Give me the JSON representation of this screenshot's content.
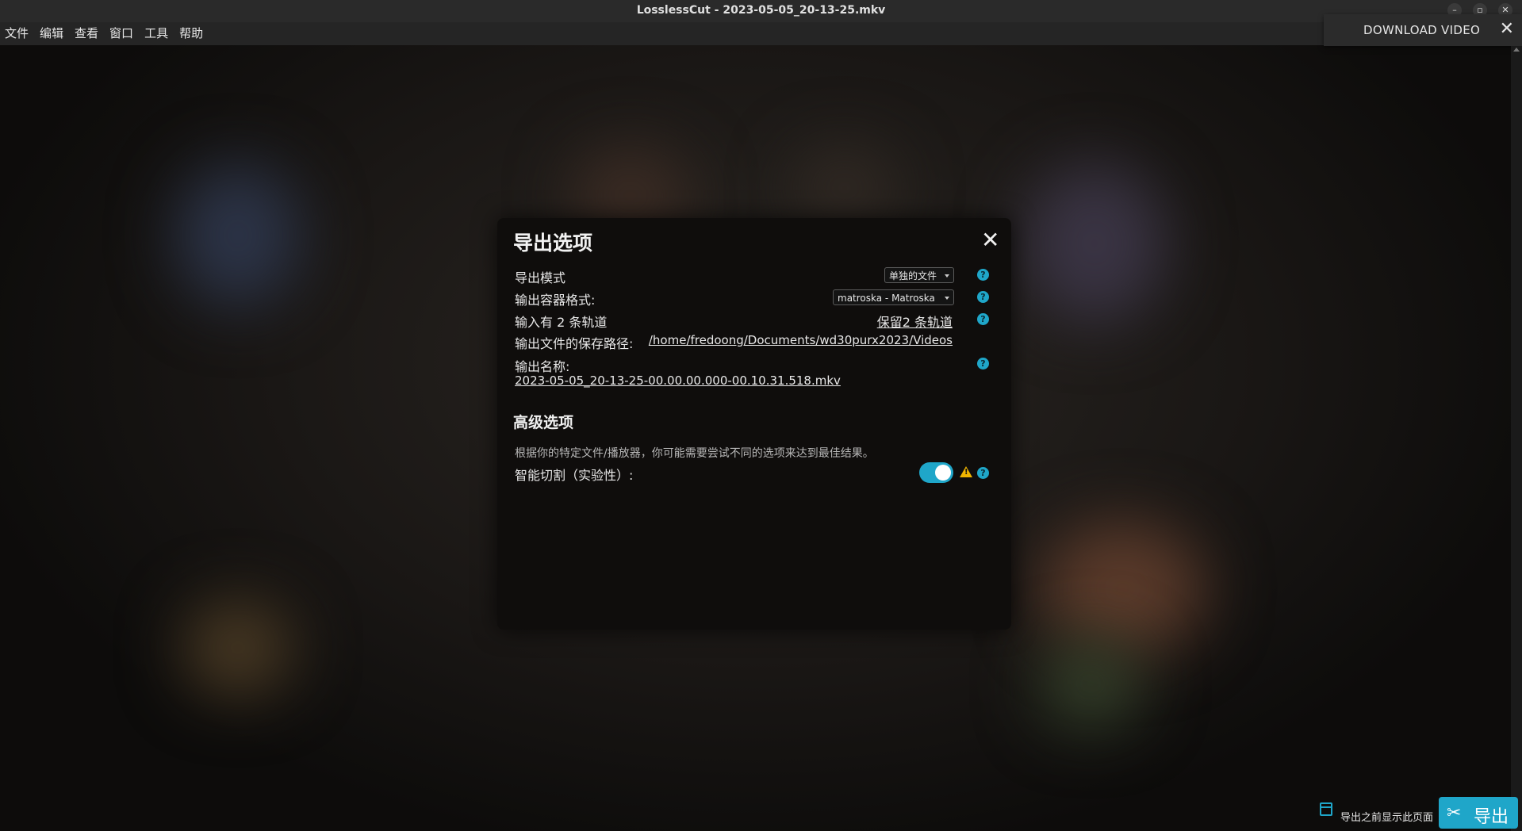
{
  "window": {
    "title": "LosslessCut - 2023-05-05_20-13-25.mkv"
  },
  "menu": {
    "items": [
      "文件",
      "编辑",
      "查看",
      "窗口",
      "工具",
      "帮助"
    ]
  },
  "download_panel": {
    "label": "DOWNLOAD VIDEO",
    "close_glyph": "✕"
  },
  "export_dialog": {
    "title": "导出选项",
    "close_glyph": "✕",
    "rows": {
      "export_mode": {
        "label": "导出模式",
        "value": "单独的文件"
      },
      "container": {
        "label": "输出容器格式:",
        "value": "matroska - Matroska"
      },
      "tracks": {
        "label": "输入有 2 条轨道",
        "value": "保留2 条轨道"
      },
      "save_path": {
        "label": "输出文件的保存路径:",
        "value": "/home/fredoong/Documents/wd30purx2023/Videos"
      },
      "output_name": {
        "label": "输出名称:",
        "value": "2023-05-05_20-13-25-00.00.00.000-00.10.31.518.mkv"
      }
    },
    "advanced": {
      "title": "高级选项",
      "description": "根据你的特定文件/播放器，你可能需要尝试不同的选项来达到最佳结果。",
      "smart_cut": {
        "label": "智能切割（实验性）:",
        "enabled": true
      }
    },
    "help_glyph": "?",
    "warning_glyph": "!"
  },
  "footer": {
    "show_page_label": "导出之前显示此页面",
    "export_label": "导出"
  },
  "colors": {
    "accent": "#1fa6c9",
    "warning": "#f0b400",
    "dialog_bg": "#0f0d0c"
  }
}
